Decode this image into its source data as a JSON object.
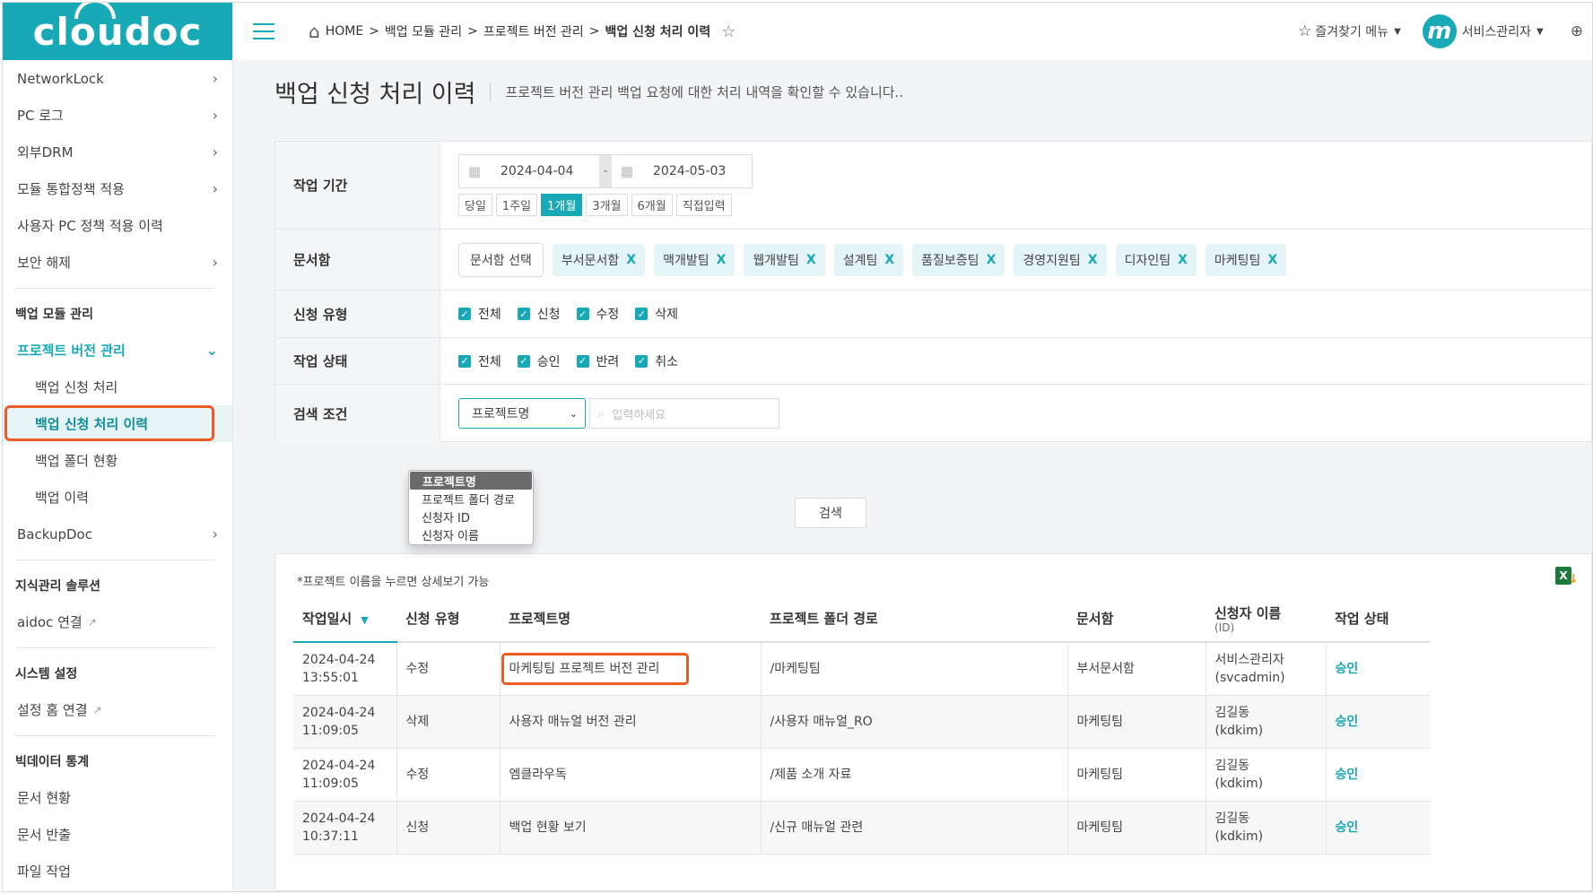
{
  "brand": {
    "logo_text": "cloudoc",
    "accent": "#17a9b6",
    "highlight": "#ee5a24"
  },
  "sidebar": {
    "items_top": [
      {
        "label": "NetworkLock",
        "chevron": "›"
      },
      {
        "label": "PC 로그",
        "chevron": "›"
      },
      {
        "label": "외부DRM",
        "chevron": "›"
      },
      {
        "label": "모듈 통합정책 적용",
        "chevron": "›"
      },
      {
        "label": "사용자 PC 정책 적용 이력",
        "chevron": ""
      },
      {
        "label": "보안 해제",
        "chevron": "›"
      }
    ],
    "section_backup": "백업 모듈 관리",
    "group_open": {
      "label": "프로젝트 버전 관리",
      "chevron": "⌄"
    },
    "sub_items": [
      "백업 신청 처리",
      "백업 신청 처리 이력",
      "백업 폴더 현황",
      "백업 이력"
    ],
    "backupdoc": {
      "label": "BackupDoc",
      "chevron": "›"
    },
    "section_knowledge": "지식관리 솔루션",
    "aidoc_link": "aidoc 연결",
    "section_system": "시스템 설정",
    "settings_link": "설정 홈 연결",
    "section_bigdata": "빅데이터 통계",
    "bigdata_items": [
      "문서 현황",
      "문서 반출",
      "파일 작업"
    ],
    "external_icon": "↗"
  },
  "topbar": {
    "breadcrumb": {
      "home": "HOME",
      "sep": ">",
      "items": [
        "백업 모듈 관리",
        "프로젝트 버전 관리"
      ],
      "current": "백업 신청 처리 이력"
    },
    "favorites_label": "즐겨찾기 메뉴",
    "user_label": "서비스관리자",
    "avatar_letter": "m"
  },
  "page": {
    "title": "백업 신청 처리 이력",
    "description": "프로젝트 버전 관리 백업 요청에 대한 처리 내역을 확인할 수 있습니다.."
  },
  "filter": {
    "period": {
      "label": "작업 기간",
      "start_date": "2024-04-04",
      "end_date": "2024-05-03",
      "dash": "-",
      "buttons": [
        "당일",
        "1주일",
        "1개월",
        "3개월",
        "6개월",
        "직접입력"
      ],
      "active": "1개월"
    },
    "doc": {
      "label": "문서함",
      "select_label": "문서함 선택",
      "tags": [
        "부서문서함",
        "맥개발팀",
        "웹개발팀",
        "설계팀",
        "품질보증팀",
        "경영지원팀",
        "디자인팀",
        "마케팅팀"
      ],
      "tag_remove": "X"
    },
    "request_type": {
      "label": "신청 유형",
      "options": [
        "전체",
        "신청",
        "수정",
        "삭제"
      ]
    },
    "work_status": {
      "label": "작업 상태",
      "options": [
        "전체",
        "승인",
        "반려",
        "취소"
      ]
    },
    "search": {
      "label": "검색 조건",
      "selected": "프로젝트명",
      "placeholder": "입력하세요",
      "options": [
        "프로젝트명",
        "프로젝트 폴더 경로",
        "신청자 ID",
        "신청자 이름"
      ],
      "button": "검색"
    }
  },
  "results": {
    "hint": "*프로젝트 이름을 누르면 상세보기 가능",
    "excel_label": "X",
    "columns": [
      {
        "label": "작업일시",
        "sub": ""
      },
      {
        "label": "신청 유형",
        "sub": ""
      },
      {
        "label": "프로젝트명",
        "sub": ""
      },
      {
        "label": "프로젝트 폴더 경로",
        "sub": ""
      },
      {
        "label": "문서함",
        "sub": ""
      },
      {
        "label": "신청자 이름",
        "sub": "(ID)"
      },
      {
        "label": "작업 상태",
        "sub": ""
      }
    ],
    "rows": [
      {
        "date": "2024-04-24",
        "time": "13:55:01",
        "type": "수정",
        "project": "마케팅팀 프로젝트 버전 관리",
        "path": "/마케팅팀",
        "box": "부서문서함",
        "name": "서비스관리자",
        "id": "(svcadmin)",
        "status": "승인"
      },
      {
        "date": "2024-04-24",
        "time": "11:09:05",
        "type": "삭제",
        "project": "사용자 매뉴얼 버전 관리",
        "path": "/사용자 매뉴얼_RO",
        "box": "마케팅팀",
        "name": "김길동",
        "id": "(kdkim)",
        "status": "승인"
      },
      {
        "date": "2024-04-24",
        "time": "11:09:05",
        "type": "수정",
        "project": "엠클라우독",
        "path": "/제품 소개 자료",
        "box": "마케팅팀",
        "name": "김길동",
        "id": "(kdkim)",
        "status": "승인"
      },
      {
        "date": "2024-04-24",
        "time": "10:37:11",
        "type": "신청",
        "project": "백업 현황 보기",
        "path": "/신규 매뉴얼 관련",
        "box": "마케팅팀",
        "name": "김길동",
        "id": "(kdkim)",
        "status": "승인"
      }
    ]
  }
}
